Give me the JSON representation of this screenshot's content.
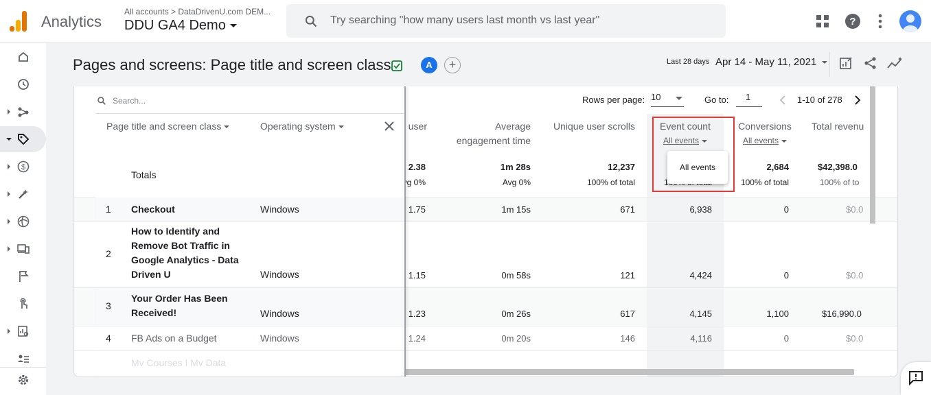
{
  "app": {
    "name": "Analytics",
    "breadcrumb": "All accounts  >  DataDrivenU.com DEM...",
    "property": "DDU GA4 Demo"
  },
  "search": {
    "placeholder": "Try searching \"how many users last month vs last year\""
  },
  "page": {
    "title": "Pages and screens: Page title and screen class",
    "comparison_chip": "A",
    "add_chip": "+"
  },
  "date": {
    "range_label": "Last 28 days",
    "range": "Apr 14 - May 11, 2021"
  },
  "table": {
    "search_placeholder": "Search...",
    "rows_per_page_label": "Rows per page:",
    "rows_per_page": "10",
    "goto_label": "Go to:",
    "goto_value": "1",
    "pagination": "1-10 of 278",
    "dim_cols": [
      "Page title and screen class",
      "Operating system"
    ],
    "metric_headers": {
      "views_per_user": "user",
      "avg_engagement": [
        "Average",
        "engagement time"
      ],
      "unique_scrolls": "Unique user scrolls",
      "event_count": "Event count",
      "event_filter": "All events",
      "conversions": "Conversions",
      "conv_filter": "All events",
      "revenue": "Total revenu"
    },
    "totals": {
      "label": "Totals",
      "views_per_user": "2.38",
      "views_per_user_sub": "vg 0%",
      "avg_engagement": "1m 28s",
      "avg_engagement_sub": "Avg 0%",
      "unique_scrolls": "12,237",
      "unique_scrolls_sub": "100% of total",
      "event_count_sub": "100% of total",
      "conversions": "2,684",
      "conversions_sub": "100% of total",
      "revenue": "$42,398.0",
      "revenue_sub": "100% of to"
    },
    "rows": [
      {
        "n": "1",
        "title": "Checkout",
        "os": "Windows",
        "vpu": "1.75",
        "eng": "1m 15s",
        "scrolls": "671",
        "events": "6,938",
        "conv": "0",
        "rev": "$0.0"
      },
      {
        "n": "2",
        "title": "How to Identify and Remove Bot Traffic in Google Analytics - Data Driven U",
        "os": "Windows",
        "vpu": "1.15",
        "eng": "0m 58s",
        "scrolls": "121",
        "events": "4,424",
        "conv": "0",
        "rev": "$0.0"
      },
      {
        "n": "3",
        "title": "Your Order Has Been Received!",
        "os": "Windows",
        "vpu": "1.23",
        "eng": "0m 26s",
        "scrolls": "617",
        "events": "4,145",
        "conv": "1,100",
        "rev": "$16,990.0"
      },
      {
        "n": "4",
        "title": "FB Ads on a Budget",
        "os": "Windows",
        "vpu": "1.24",
        "eng": "0m 20s",
        "scrolls": "146",
        "events": "4,116",
        "conv": "0",
        "rev": "$0.0"
      },
      {
        "title": "My Courses | My Data"
      }
    ],
    "dropdown_option": "All events"
  },
  "icons": [
    "home-icon",
    "clock-icon",
    "share-icon",
    "tag-icon",
    "dollar-icon",
    "wand-icon",
    "globe-icon",
    "devices-icon",
    "flag-icon",
    "touch-icon",
    "report-icon",
    "list-icon",
    "settings-icon"
  ]
}
